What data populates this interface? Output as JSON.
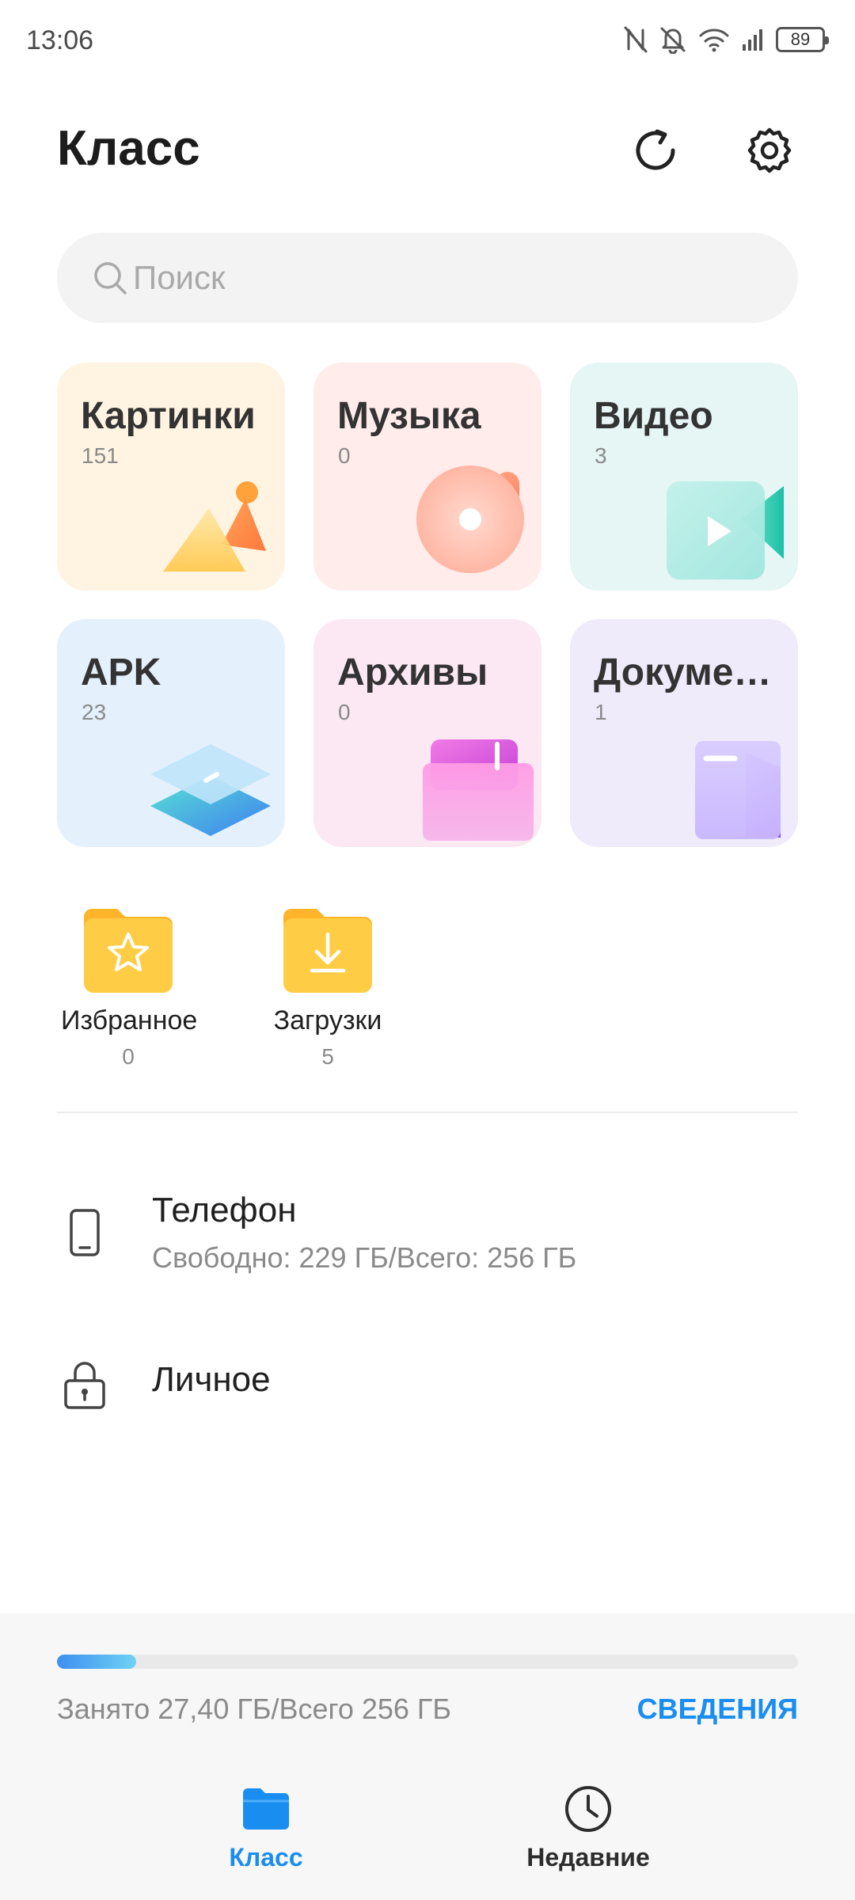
{
  "status_bar": {
    "time": "13:06",
    "battery": "89",
    "icons": [
      "nfc-icon",
      "bell-off-icon",
      "wifi-icon",
      "signal-icon",
      "battery-icon"
    ]
  },
  "header": {
    "title": "Класс",
    "actions": [
      "refresh-icon",
      "gear-icon"
    ]
  },
  "search": {
    "placeholder": "Поиск"
  },
  "categories": [
    {
      "name": "Картинки",
      "count": "151",
      "icon": "pictures-icon",
      "bg": "#fff4e2"
    },
    {
      "name": "Музыка",
      "count": "0",
      "icon": "music-icon",
      "bg": "#ffeceb"
    },
    {
      "name": "Видео",
      "count": "3",
      "icon": "video-icon",
      "bg": "#e6f6f5"
    },
    {
      "name": "APK",
      "count": "23",
      "icon": "apk-icon",
      "bg": "#e4f1fd"
    },
    {
      "name": "Архивы",
      "count": "0",
      "icon": "archive-icon",
      "bg": "#fbe8f3"
    },
    {
      "name": "Докуме…",
      "count": "1",
      "icon": "document-icon",
      "bg": "#efebfb"
    }
  ],
  "folders": [
    {
      "label": "Избранное",
      "count": "0",
      "icon": "star-folder-icon"
    },
    {
      "label": "Загрузки",
      "count": "5",
      "icon": "download-folder-icon"
    }
  ],
  "storage": {
    "phone": {
      "title": "Телефон",
      "subtitle": "Свободно: 229 ГБ/Всего: 256 ГБ",
      "icon": "phone-icon"
    },
    "private": {
      "title": "Личное",
      "icon": "lock-icon"
    }
  },
  "bottom": {
    "usage_fraction": 0.107,
    "used_text": "Занято 27,40 ГБ/Всего 256 ГБ",
    "details_label": "СВЕДЕНИЯ",
    "nav": [
      {
        "label": "Класс",
        "icon": "folder-icon",
        "active": true
      },
      {
        "label": "Недавние",
        "icon": "clock-icon",
        "active": false
      }
    ]
  },
  "colors": {
    "accent": "#1a8df0",
    "folder_yellow": "#ffc93c"
  }
}
